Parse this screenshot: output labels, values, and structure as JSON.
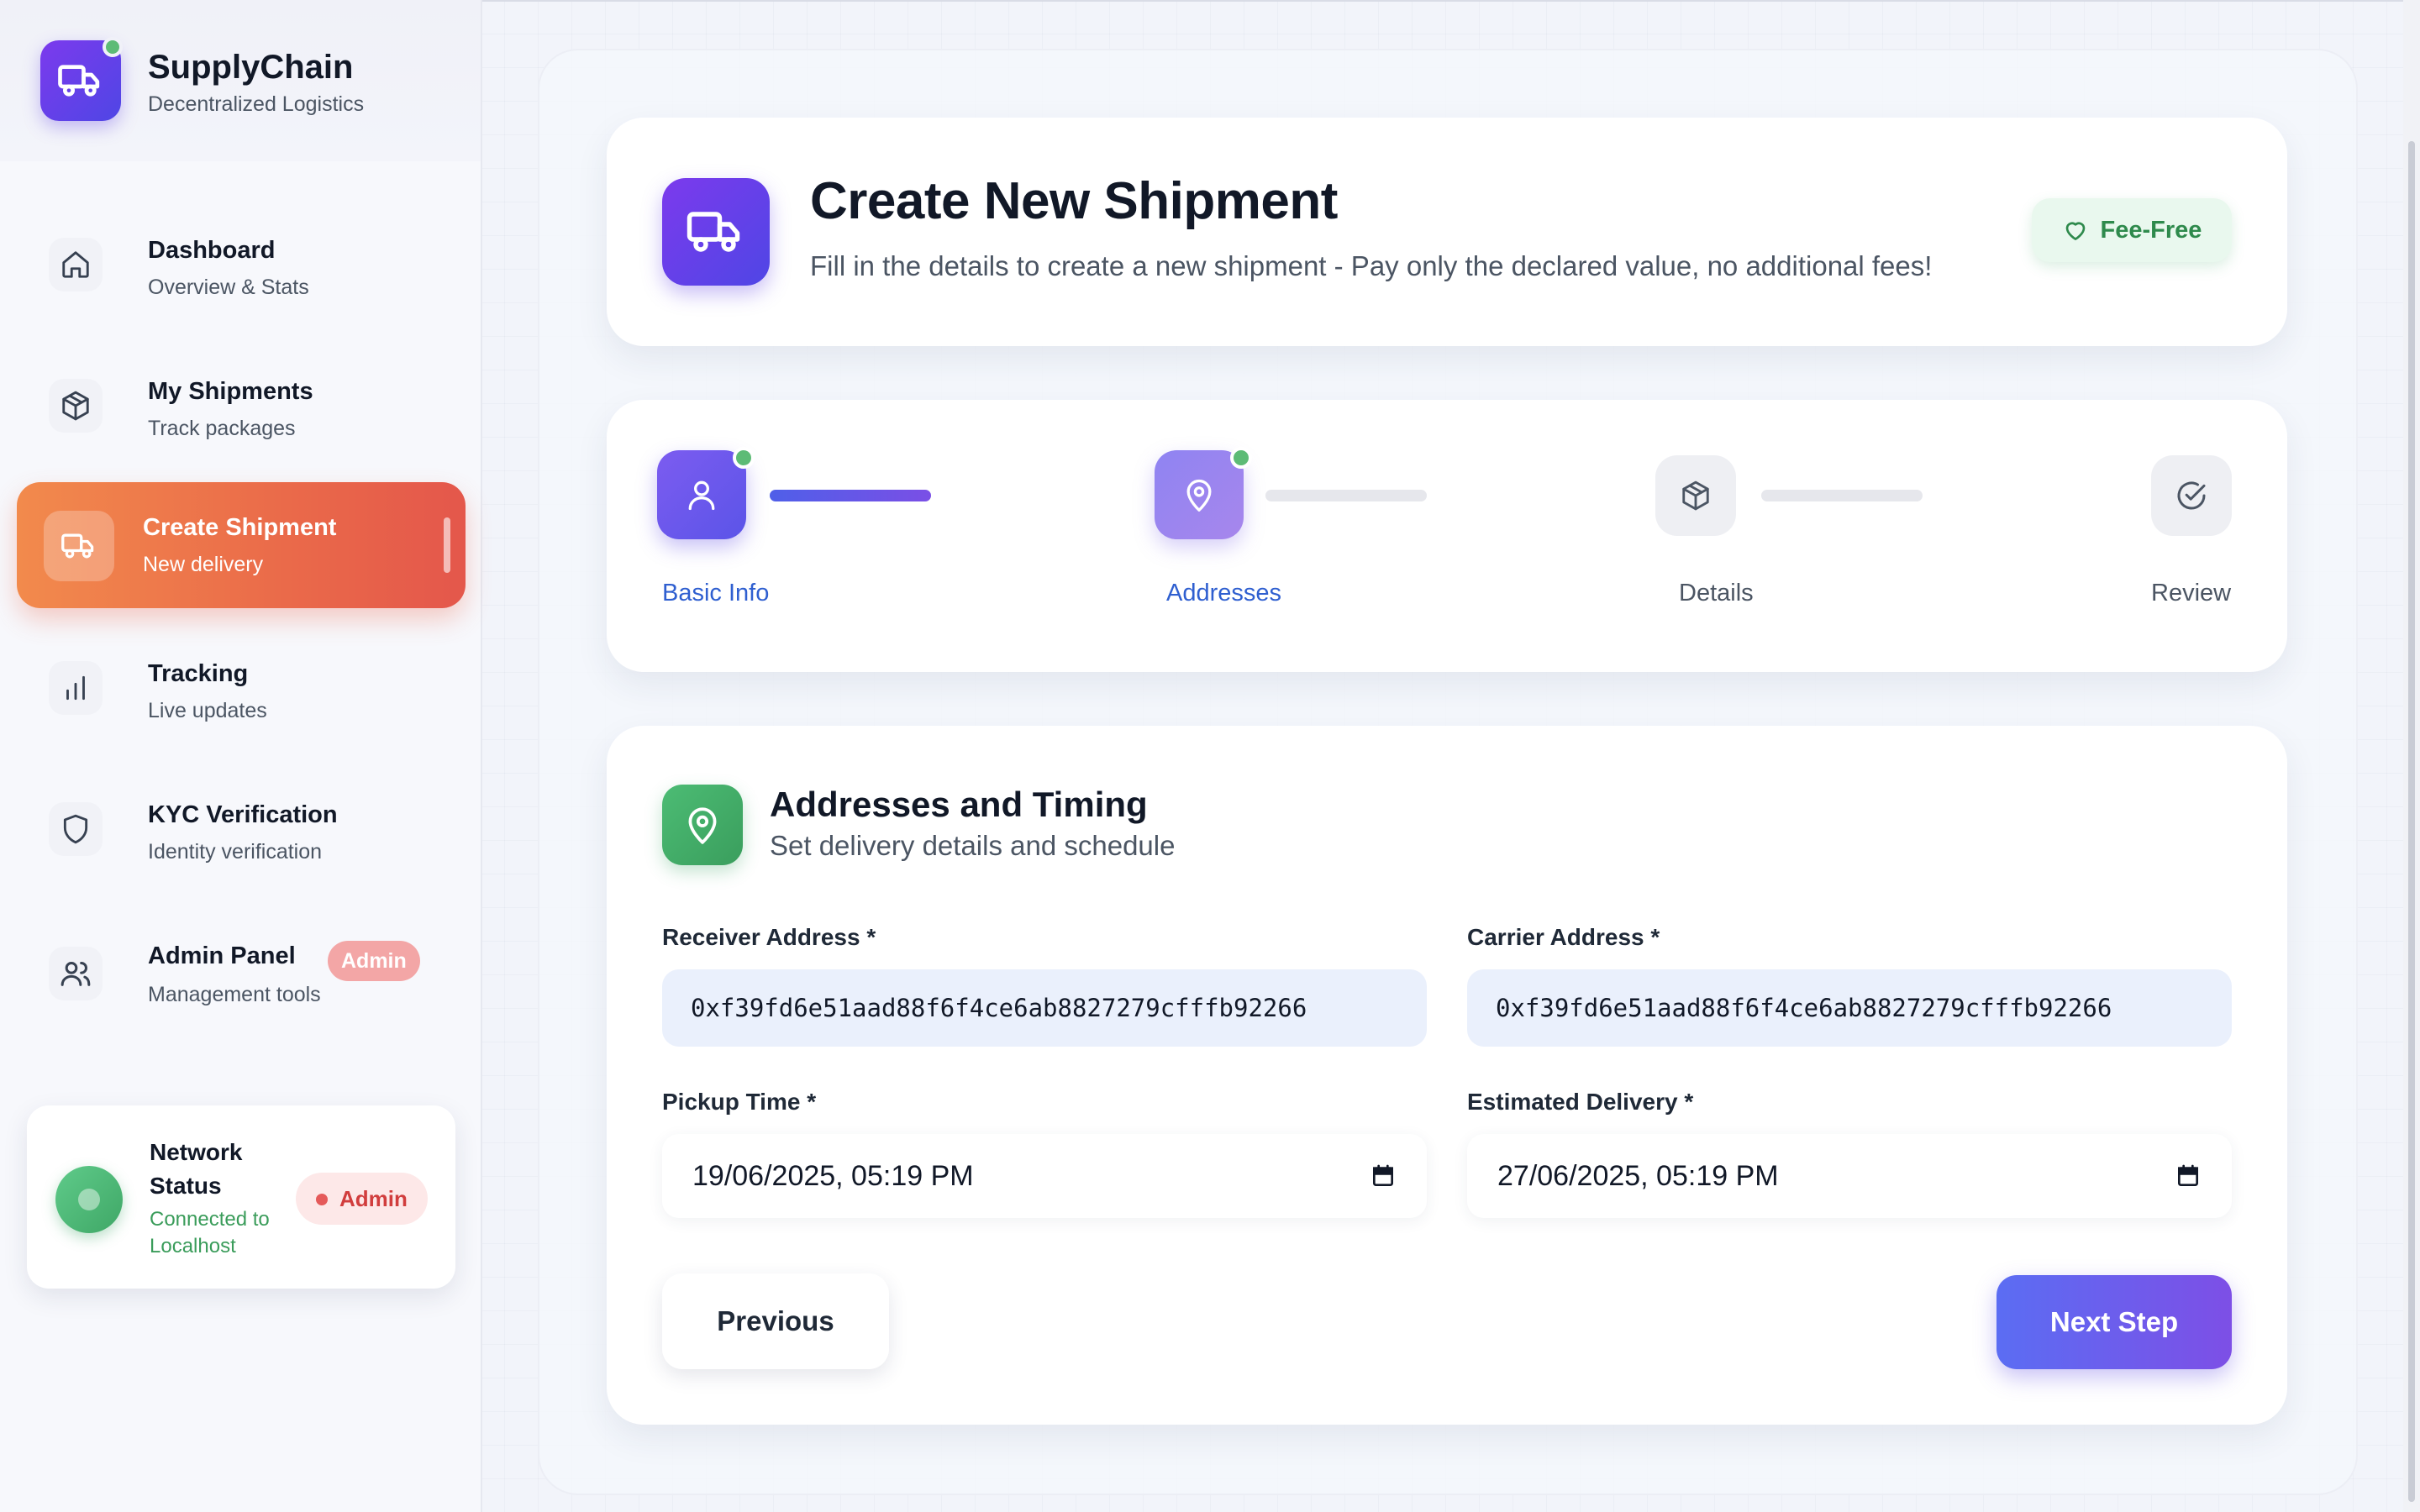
{
  "brand": {
    "title": "SupplyChain",
    "subtitle": "Decentralized Logistics",
    "icon": "truck-icon"
  },
  "sidebar": {
    "items": [
      {
        "title": "Dashboard",
        "subtitle": "Overview & Stats",
        "icon": "home-icon",
        "active": false
      },
      {
        "title": "My Shipments",
        "subtitle": "Track packages",
        "icon": "package-icon",
        "active": false
      },
      {
        "title": "Create Shipment",
        "subtitle": "New delivery",
        "icon": "truck-icon",
        "active": true
      },
      {
        "title": "Tracking",
        "subtitle": "Live updates",
        "icon": "bar-chart-icon",
        "active": false
      },
      {
        "title": "KYC Verification",
        "subtitle": "Identity verification",
        "icon": "shield-icon",
        "active": false
      },
      {
        "title": "Admin Panel",
        "subtitle": "Management tools",
        "icon": "users-icon",
        "active": false,
        "badge": "Admin"
      }
    ]
  },
  "network": {
    "title": "Network Status",
    "status": "Connected to Localhost",
    "badge": "Admin",
    "status_color": "#3a9c5a"
  },
  "header": {
    "title": "Create New Shipment",
    "subtitle": "Fill in the details to create a new shipment - Pay only the declared value, no additional fees!",
    "badge": "Fee-Free"
  },
  "steps": [
    {
      "label": "Basic Info",
      "icon": "user-icon",
      "state": "done"
    },
    {
      "label": "Addresses",
      "icon": "map-pin-icon",
      "state": "current"
    },
    {
      "label": "Details",
      "icon": "package-icon",
      "state": "todo"
    },
    {
      "label": "Review",
      "icon": "check-circle-icon",
      "state": "todo"
    }
  ],
  "form": {
    "title": "Addresses and Timing",
    "subtitle": "Set delivery details and schedule",
    "receiver_label": "Receiver Address *",
    "receiver_value": "0xf39fd6e51aad88f6f4ce6ab8827279cfffb92266",
    "carrier_label": "Carrier Address *",
    "carrier_value": "0xf39fd6e51aad88f6f4ce6ab8827279cfffb92266",
    "pickup_label": "Pickup Time *",
    "pickup_value": "19/06/2025, 05:19 PM",
    "delivery_label": "Estimated Delivery *",
    "delivery_value": "27/06/2025, 05:19 PM",
    "prev_label": "Previous",
    "next_label": "Next Step"
  },
  "colors": {
    "accent": "#5b54e8",
    "active_nav_start": "#f28a4c",
    "active_nav_end": "#e4574b",
    "success": "#3fa766"
  }
}
